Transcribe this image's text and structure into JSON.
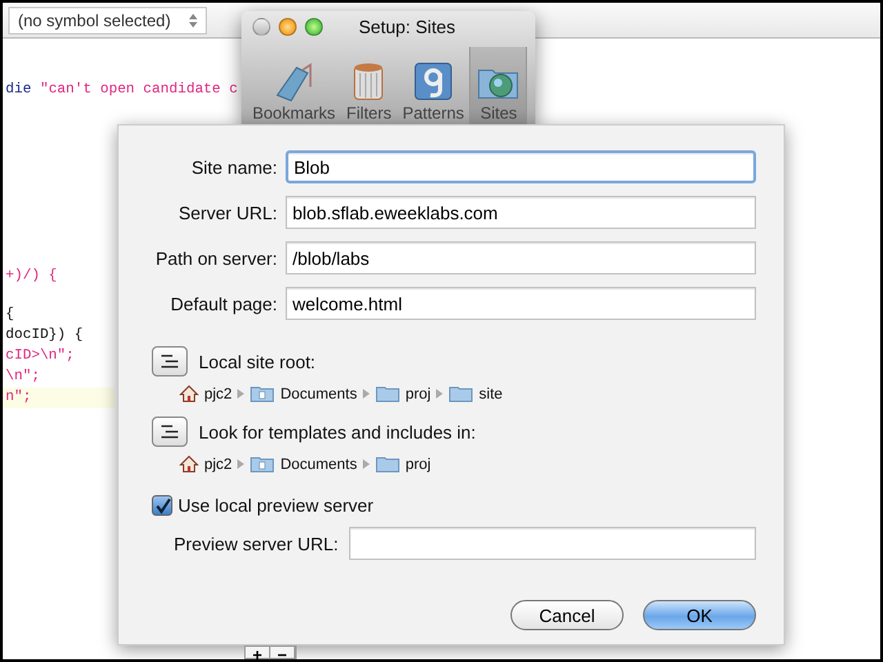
{
  "symbol_menu": {
    "value": "(no symbol selected)"
  },
  "code_blocks": [
    [
      {
        "tokens": [
          {
            "text": "die ",
            "kind": "keyword"
          },
          {
            "text": "\"can't open candidate c",
            "kind": "string"
          }
        ],
        "current": false
      }
    ],
    [
      {
        "tokens": [
          {
            "text": "+)/) {",
            "kind": "mixed"
          }
        ],
        "current": false
      }
    ],
    [
      {
        "tokens": [
          {
            "text": "{",
            "kind": "plain"
          }
        ],
        "current": false
      },
      {
        "tokens": [
          {
            "text": "docID}) {",
            "kind": "plain"
          }
        ],
        "current": false
      },
      {
        "tokens": [
          {
            "text": "cID>\\n\";",
            "kind": "string"
          }
        ],
        "current": false
      },
      {
        "tokens": [
          {
            "text": "\\n\";",
            "kind": "string"
          }
        ],
        "current": false
      },
      {
        "tokens": [
          {
            "text": "n\";",
            "kind": "string"
          }
        ],
        "current": true
      }
    ]
  ],
  "window": {
    "title": "Setup: Sites",
    "controls": [
      {
        "kind": "close",
        "active": false
      },
      {
        "kind": "minimize",
        "active": true
      },
      {
        "kind": "zoom",
        "active": true
      }
    ]
  },
  "toolbar": [
    {
      "label": "Bookmarks",
      "kind": "tag",
      "selected": false
    },
    {
      "label": "Filters",
      "kind": "cylinder",
      "selected": false
    },
    {
      "label": "Patterns",
      "kind": "pattern",
      "selected": false
    },
    {
      "label": "Sites",
      "kind": "globe-folder",
      "selected": true
    }
  ],
  "form": [
    {
      "label": "Site name:",
      "value": "Blob",
      "focused": true
    },
    {
      "label": "Server URL:",
      "value": "blob.sflab.eweeklabs.com",
      "focused": false
    },
    {
      "label": "Path on server:",
      "value": "/blob/labs",
      "focused": false
    },
    {
      "label": "Default page:",
      "value": "welcome.html",
      "focused": false
    }
  ],
  "locations": [
    {
      "label": "Local site root:",
      "path": [
        {
          "name": "pjc2",
          "kind": "home"
        },
        {
          "name": "Documents",
          "kind": "documents"
        },
        {
          "name": "proj",
          "kind": "folder"
        },
        {
          "name": "site",
          "kind": "folder"
        }
      ]
    },
    {
      "label": "Look for templates and includes in:",
      "path": [
        {
          "name": "pjc2",
          "kind": "home"
        },
        {
          "name": "Documents",
          "kind": "documents"
        },
        {
          "name": "proj",
          "kind": "folder"
        }
      ]
    }
  ],
  "preview": {
    "label": "Use local preview server",
    "checked": true,
    "url_label": "Preview server URL:"
  },
  "buttons": [
    {
      "label": "Cancel",
      "default": false
    },
    {
      "label": "OK",
      "default": true
    }
  ],
  "list_buttons": [
    "+",
    "−"
  ]
}
